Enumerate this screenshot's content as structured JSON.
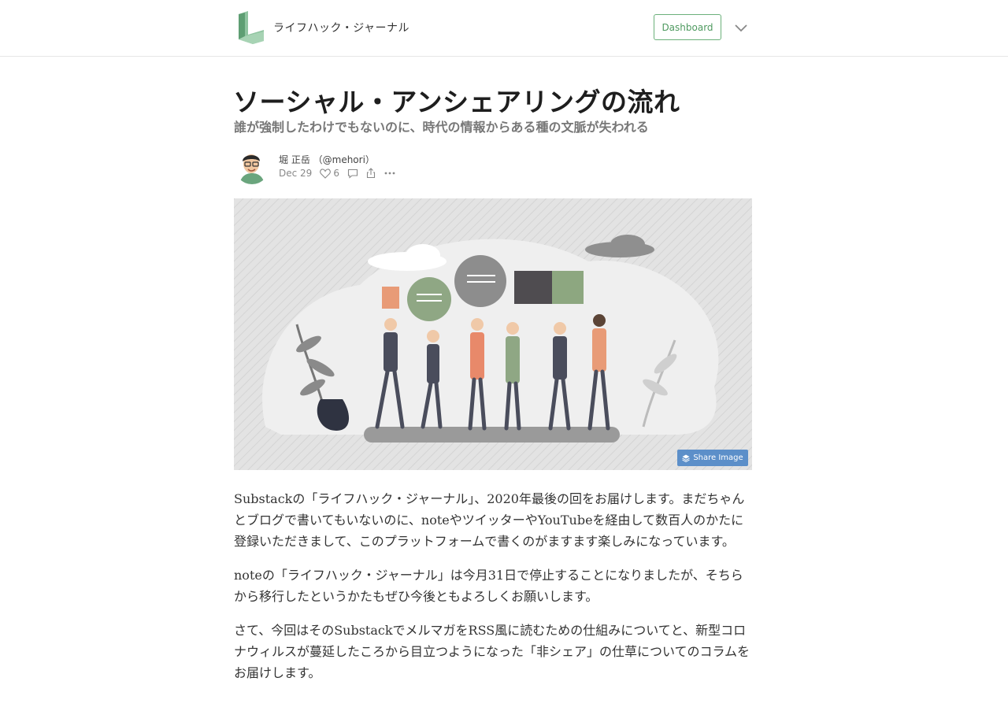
{
  "header": {
    "publication_name": "ライフハック・ジャーナル",
    "dashboard_label": "Dashboard",
    "accent_color": "#6bb07a"
  },
  "article": {
    "title": "ソーシャル・アンシェアリングの流れ",
    "subtitle": "誰が強制したわけでもないのに、時代の情報からある種の文脈が失われる",
    "author": "堀 正岳 （@mehori）",
    "date": "Dec 29",
    "like_count": "6",
    "share_image_label": "Share Image",
    "paragraphs": [
      "Substackの「ライフハック・ジャーナル」、2020年最後の回をお届けします。まだちゃんとブログで書いてもいないのに、noteやツイッターやYouTubeを経由して数百人のかたに登録いただきまして、このプラットフォームで書くのがますます楽しみになっています。",
      "noteの「ライフハック・ジャーナル」は今月31日で停止することになりましたが、そちらから移行したというかたもぜひ今後ともよろしくお願いします。",
      "さて、今回はそのSubstackでメルマガをRSS風に読むための仕組みについてと、新型コロナウィルスが蔓延したころから目立つようになった「非シェア」の仕草についてのコラムをお届けします。"
    ]
  },
  "icons": [
    "logo-icon",
    "chevron-down-icon",
    "heart-icon",
    "comment-icon",
    "share-icon",
    "more-icon",
    "layers-icon"
  ]
}
